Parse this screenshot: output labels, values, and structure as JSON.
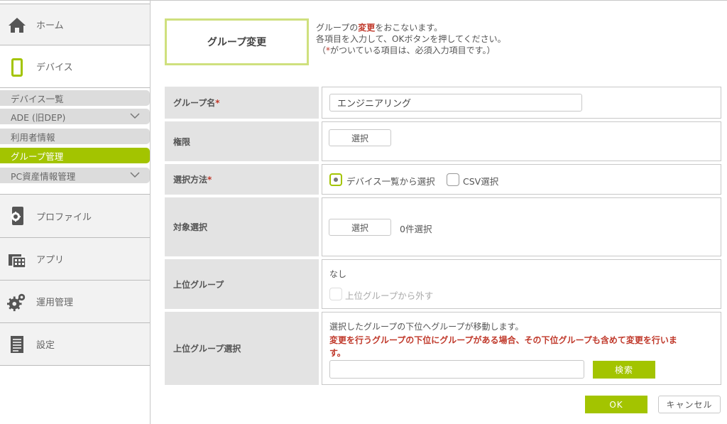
{
  "sidebar": {
    "home": "ホーム",
    "device": "デバイス",
    "sub_items": [
      {
        "label": "デバイス一覧"
      },
      {
        "label": "ADE (旧DEP)"
      },
      {
        "label": "利用者情報"
      },
      {
        "label": "グループ管理"
      },
      {
        "label": "PC資産情報管理"
      }
    ],
    "profile": "プロファイル",
    "app": "アプリ",
    "operation": "運用管理",
    "settings": "設定"
  },
  "header": {
    "title": "グループ変更",
    "desc_prefix": "グループの",
    "desc_red": "変更",
    "desc_suffix": "をおこないます。",
    "desc_line2": "各項目を入力して、OKボタンを押してください。",
    "desc_line3_open": "（",
    "desc_line3_star": "*",
    "desc_line3_rest": "がついている項目は、必須入力項目です。）"
  },
  "form": {
    "group_name_label": "グループ名",
    "group_name_value": "エンジニアリング",
    "required_mark": "*",
    "permission_label": "権限",
    "select_button": "選択",
    "select_method_label": "選択方法",
    "method_device_list": "デバイス一覧から選択",
    "method_csv": "CSV選択",
    "target_label": "対象選択",
    "target_count": "0件選択",
    "parent_group_label": "上位グループ",
    "parent_group_value": "なし",
    "remove_parent": "上位グループから外す",
    "parent_select_label": "上位グループ選択",
    "parent_select_note": "選択したグループの下位へグループが移動します。",
    "parent_select_warning_1": "変更を行うグループの下位にグループがある場合、その下位グループも含めて変更を行いま",
    "parent_select_warning_2": "す。",
    "search_button": "検索"
  },
  "actions": {
    "ok": "OK",
    "cancel": "キャンセル"
  },
  "colors": {
    "accent": "#a3c400",
    "title_border": "#cfe07e",
    "required": "#c0392b"
  }
}
